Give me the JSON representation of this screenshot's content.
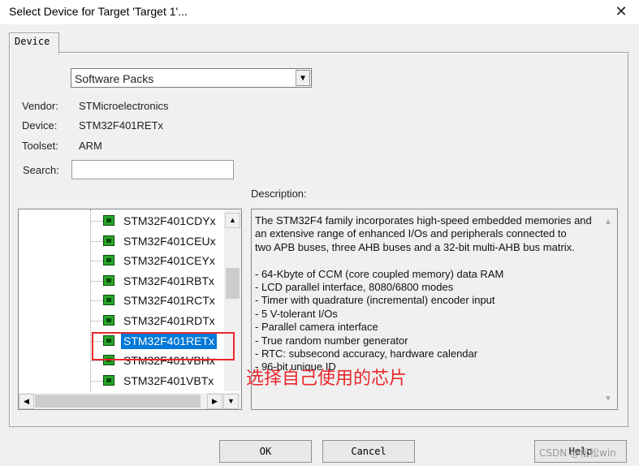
{
  "window": {
    "title": "Select Device for Target 'Target 1'...",
    "close_glyph": "✕"
  },
  "tab": {
    "label": "Device"
  },
  "pack_select": {
    "value": "Software Packs",
    "arrow": "▼"
  },
  "fields": {
    "vendor_label": "Vendor:",
    "vendor_value": "STMicroelectronics",
    "device_label": "Device:",
    "device_value": "STM32F401RETx",
    "toolset_label": "Toolset:",
    "toolset_value": "ARM",
    "search_label": "Search:",
    "search_value": ""
  },
  "device_tree": {
    "items": [
      "STM32F401CDYx",
      "STM32F401CEUx",
      "STM32F401CEYx",
      "STM32F401RBTx",
      "STM32F401RCTx",
      "STM32F401RDTx",
      "STM32F401RETx",
      "STM32F401VBHx",
      "STM32F401VBTx"
    ],
    "selected_index": 6,
    "icon": "chip-icon"
  },
  "description": {
    "label": "Description:",
    "lines": [
      "The STM32F4 family incorporates high-speed embedded memories and",
      "an extensive range of enhanced I/Os and peripherals connected to",
      "two APB buses, three AHB buses and a 32-bit multi-AHB bus matrix.",
      "",
      "- 64-Kbyte of CCM (core coupled memory) data RAM",
      "- LCD parallel interface, 8080/6800 modes",
      "- Timer with quadrature (incremental) encoder input",
      "- 5 V-tolerant I/Os",
      "- Parallel camera interface",
      "- True random number generator",
      "- RTC: subsecond accuracy, hardware calendar",
      "- 96-bit unique ID"
    ]
  },
  "annotation": {
    "text": "选择自己使用的芯片",
    "color": "#e8282c"
  },
  "buttons": {
    "ok": "OK",
    "cancel": "Cancel",
    "help": "Help"
  },
  "watermark": "CSDN @松松win",
  "colors": {
    "selection": "#0078d7",
    "annotation": "#e8282c"
  }
}
